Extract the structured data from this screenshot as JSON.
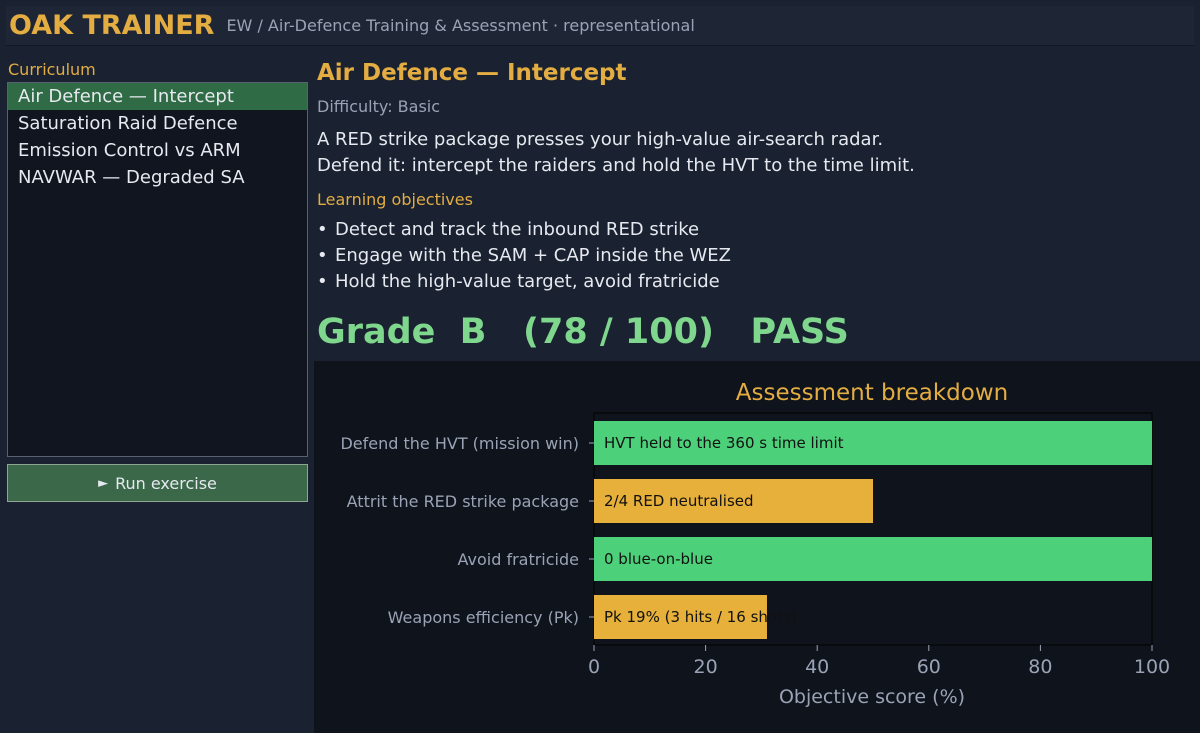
{
  "header": {
    "app_title": "OAK TRAINER",
    "subtitle": "EW / Air-Defence Training & Assessment · representational"
  },
  "sidebar": {
    "label": "Curriculum",
    "items": [
      {
        "label": "Air Defence — Intercept",
        "selected": true
      },
      {
        "label": "Saturation Raid Defence",
        "selected": false
      },
      {
        "label": "Emission Control vs ARM",
        "selected": false
      },
      {
        "label": "NAVWAR — Degraded SA",
        "selected": false
      }
    ],
    "run_button": {
      "icon": "play-icon",
      "label": "Run exercise"
    }
  },
  "main": {
    "title": "Air Defence — Intercept",
    "difficulty": "Difficulty: Basic",
    "description": "A RED strike package presses your high-value air-search radar. Defend it: intercept the raiders and hold the HVT to the time limit.",
    "objectives_label": "Learning objectives",
    "objectives": [
      "Detect and track the inbound RED strike",
      "Engage with the SAM + CAP inside the WEZ",
      "Hold the high-value target, avoid fratricide"
    ],
    "grade": {
      "label": "Grade",
      "letter": "B",
      "score": "(78 / 100)",
      "result": "PASS"
    }
  },
  "colors": {
    "accent": "#e3ad42",
    "pass_green": "#4dd07a",
    "partial_amber": "#e6b03a",
    "selected_item": "#2f6b44"
  },
  "chart_data": {
    "type": "bar",
    "orientation": "horizontal",
    "title": "Assessment breakdown",
    "xlabel": "Objective score (%)",
    "ylabel": "",
    "xlim": [
      0,
      100
    ],
    "xticks": [
      0,
      20,
      40,
      60,
      80,
      100
    ],
    "grid": false,
    "categories": [
      "Defend the HVT (mission win)",
      "Attrit the RED strike package",
      "Avoid fratricide",
      "Weapons efficiency (Pk)"
    ],
    "values": [
      100,
      50,
      100,
      31
    ],
    "bar_labels": [
      "HVT held to the 360 s time limit",
      "2/4 RED neutralised",
      "0 blue-on-blue",
      "Pk 19% (3 hits / 16 shots)"
    ],
    "bar_colors": [
      "#4dd07a",
      "#e6b03a",
      "#4dd07a",
      "#e6b03a"
    ]
  }
}
